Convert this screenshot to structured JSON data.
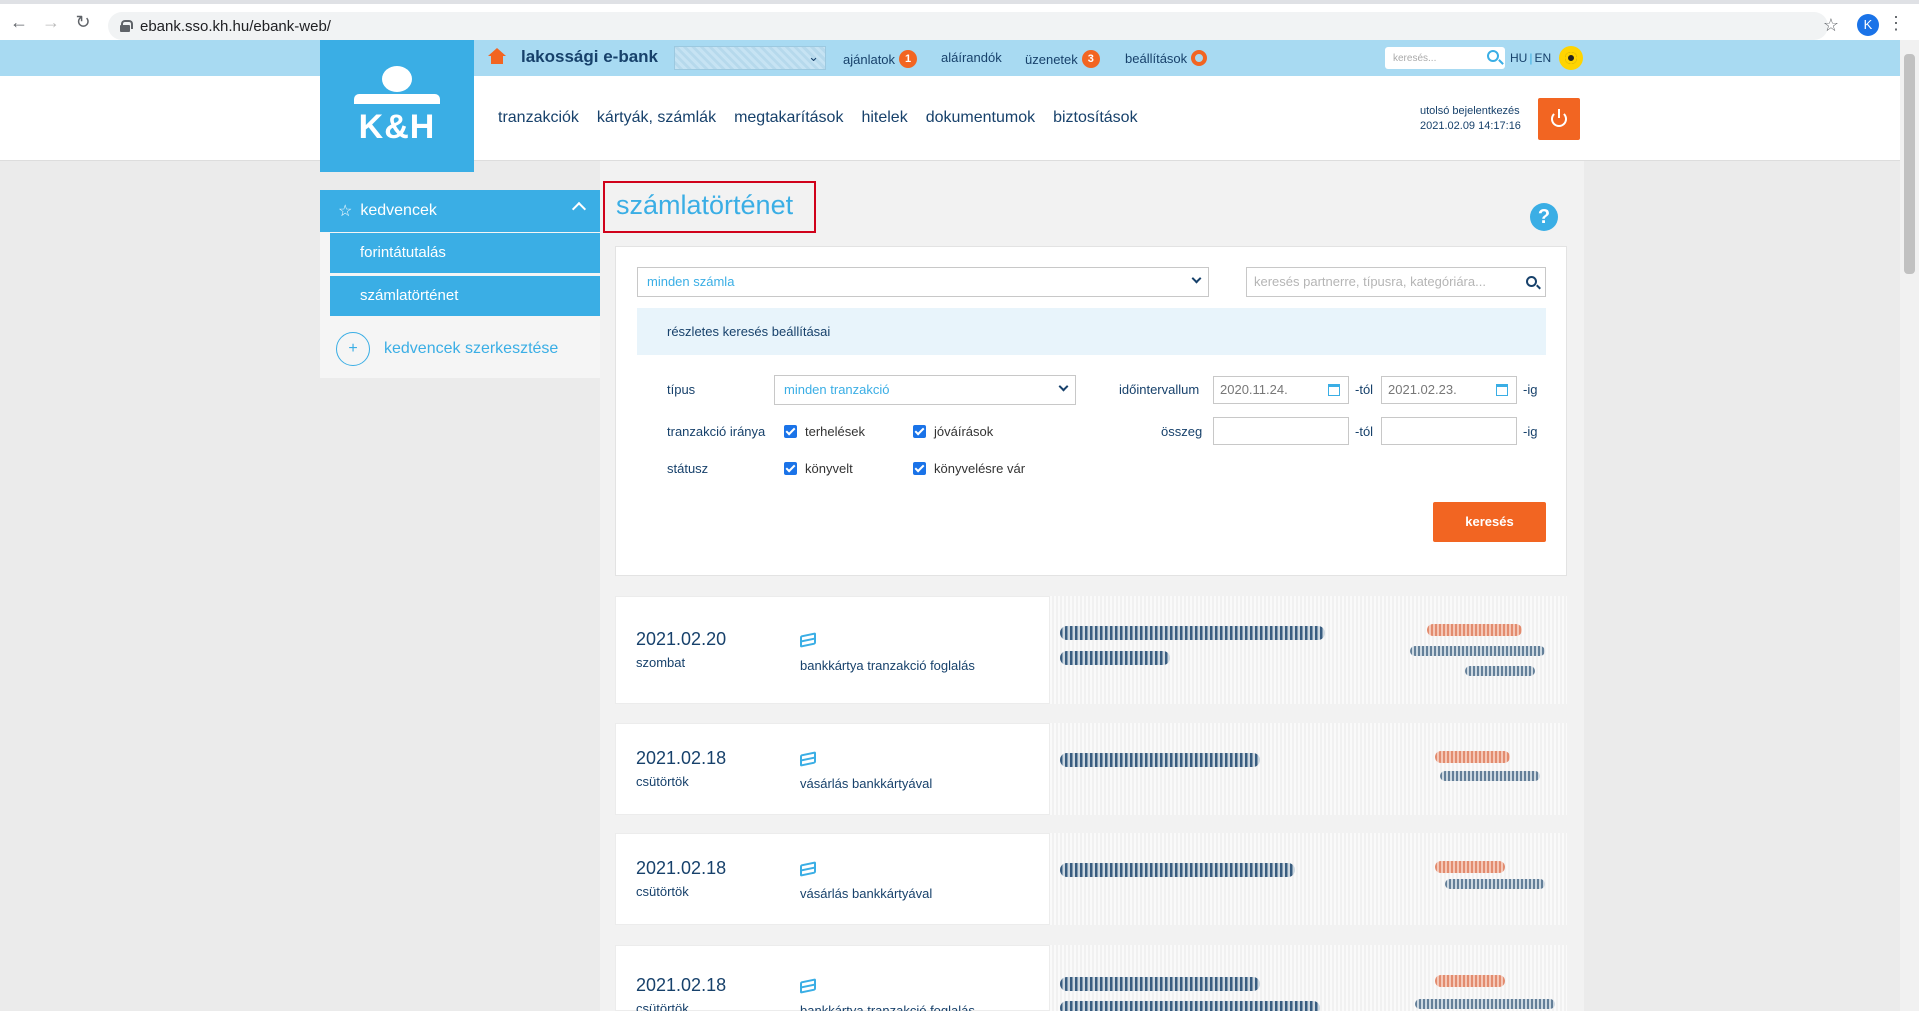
{
  "browser": {
    "url": "ebank.sso.kh.hu/ebank-web/",
    "profile_initial": "K"
  },
  "logo": {
    "text": "K&H"
  },
  "topbar": {
    "title": "lakossági e-bank",
    "links": {
      "offers": "ajánlatok",
      "offers_count": "1",
      "to_sign": "aláírandók",
      "messages": "üzenetek",
      "messages_count": "3",
      "settings": "beállítások"
    },
    "search_placeholder": "keresés...",
    "lang_hu": "HU",
    "lang_en": "EN"
  },
  "mainnav": {
    "items": [
      "tranzakciók",
      "kártyák, számlák",
      "megtakarítások",
      "hitelek",
      "dokumentumok",
      "biztosítások"
    ]
  },
  "last_login": {
    "label": "utolsó bejelentkezés",
    "value": "2021.02.09 14:17:16"
  },
  "sidebar": {
    "header": "kedvencek",
    "items": [
      "forintátutalás",
      "számlatörténet"
    ],
    "edit": "kedvencek szerkesztése",
    "edit_icon": "+"
  },
  "page": {
    "title": "számlatörténet",
    "help": "?"
  },
  "filters": {
    "account": "minden számla",
    "search_placeholder": "keresés partnerre, típusra, kategóriára...",
    "detail_title": "részletes keresés beállításai",
    "type_label": "típus",
    "type_value": "minden tranzakció",
    "direction_label": "tranzakció iránya",
    "debits": "terhelések",
    "credits": "jóváírások",
    "status_label": "státusz",
    "booked": "könyvelt",
    "pending": "könyvelésre vár",
    "interval_label": "időintervallum",
    "date_from": "2020.11.24.",
    "date_to": "2021.02.23.",
    "from_suffix": "-tól",
    "to_suffix": "-ig",
    "amount_label": "összeg",
    "amount_from": "",
    "amount_to": "",
    "search_button": "keresés"
  },
  "transactions": [
    {
      "date": "2021.02.20",
      "day": "szombat",
      "desc": "bankkártya tranzakció foglalás"
    },
    {
      "date": "2021.02.18",
      "day": "csütörtök",
      "desc": "vásárlás bankkártyával"
    },
    {
      "date": "2021.02.18",
      "day": "csütörtök",
      "desc": "vásárlás bankkártyával"
    },
    {
      "date": "2021.02.18",
      "day": "csütörtök",
      "desc": "bankkártya tranzakció foglalás"
    }
  ],
  "colors": {
    "brand_blue": "#3aaee5",
    "accent_orange": "#f26522",
    "text_navy": "#17416b"
  }
}
